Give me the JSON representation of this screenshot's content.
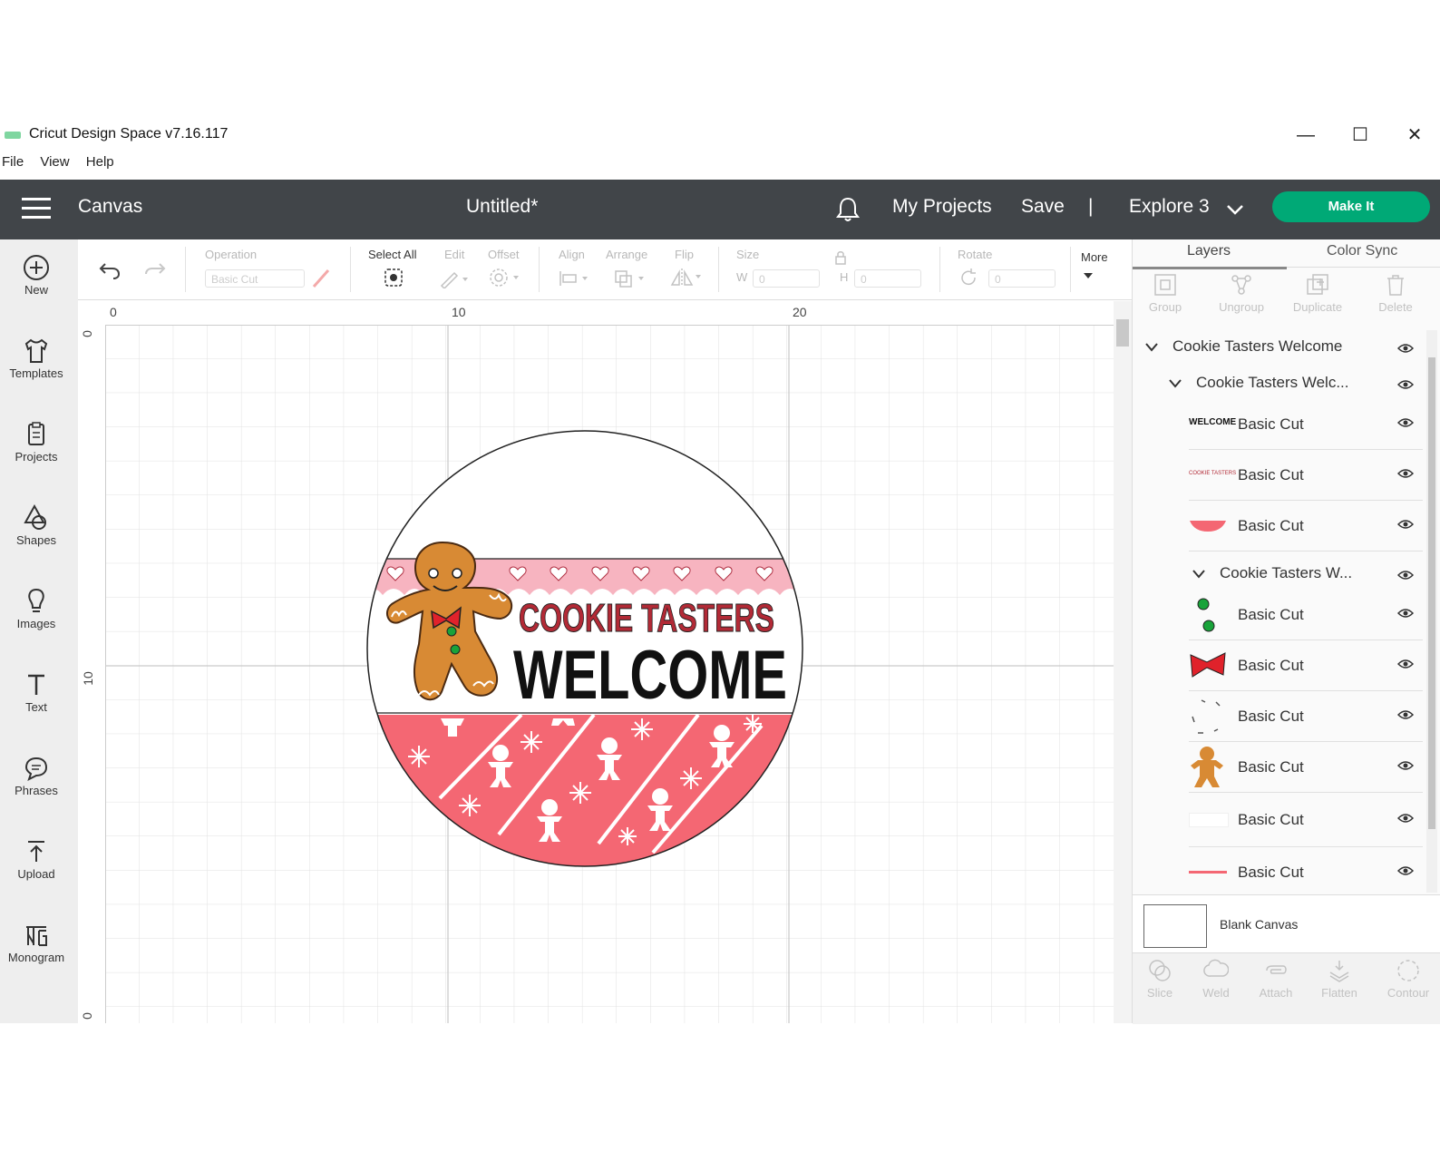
{
  "window": {
    "title": "Cricut Design Space  v7.16.117",
    "controls": [
      "minimize-icon",
      "maximize-icon",
      "close-icon"
    ]
  },
  "menu": [
    "File",
    "View",
    "Help"
  ],
  "header": {
    "section": "Canvas",
    "doc_title": "Untitled*",
    "my_projects": "My Projects",
    "save": "Save",
    "divider": "|",
    "machine": "Explore 3",
    "make_it": "Make It",
    "colors": {
      "bar": "#414549",
      "make_it": "#00a976"
    }
  },
  "sidebar": [
    {
      "label": "New",
      "icon": "plus-circle-icon"
    },
    {
      "label": "Templates",
      "icon": "shirt-icon"
    },
    {
      "label": "Projects",
      "icon": "clipboard-icon"
    },
    {
      "label": "Shapes",
      "icon": "shapes-icon"
    },
    {
      "label": "Images",
      "icon": "lightbulb-icon"
    },
    {
      "label": "Text",
      "icon": "text-icon"
    },
    {
      "label": "Phrases",
      "icon": "speech-bubble-icon"
    },
    {
      "label": "Upload",
      "icon": "upload-icon"
    },
    {
      "label": "Monogram",
      "icon": "monogram-icon"
    }
  ],
  "toolbar": {
    "operation_label": "Operation",
    "operation_value": "Basic Cut",
    "select_all": "Select All",
    "edit": "Edit",
    "offset": "Offset",
    "align": "Align",
    "arrange": "Arrange",
    "flip": "Flip",
    "size": "Size",
    "w": "W",
    "h": "H",
    "w_value": "0",
    "h_value": "0",
    "rotate": "Rotate",
    "rotate_value": "0",
    "more": "More"
  },
  "rulers": {
    "top": [
      "0",
      "10",
      "20"
    ],
    "left": [
      "0",
      "10",
      "0"
    ]
  },
  "design": {
    "line1": "COOKIE TASTERS",
    "line2": "WELCOME",
    "colors": {
      "pink": "#f46773",
      "light_pink": "#f7b4c0",
      "red_text": "#b22a36",
      "gingerbread": "#d88a34"
    }
  },
  "panel": {
    "tabs": [
      "Layers",
      "Color Sync"
    ],
    "actions": [
      "Group",
      "Ungroup",
      "Duplicate",
      "Delete"
    ],
    "layers": [
      {
        "label": "Cookie Tasters Welcome",
        "kind": "group",
        "level": 0
      },
      {
        "label": "Cookie Tasters Welc...",
        "kind": "group",
        "level": 1
      },
      {
        "label": "Basic Cut",
        "thumb": "WELCOME",
        "kind": "layer"
      },
      {
        "label": "Basic Cut",
        "thumb": "COOKIE TASTERS",
        "kind": "layer"
      },
      {
        "label": "Basic Cut",
        "thumb": "pink-band",
        "kind": "layer"
      },
      {
        "label": "Cookie Tasters W...",
        "kind": "group",
        "level": 2
      },
      {
        "label": "Basic Cut",
        "thumb": "green-buttons",
        "kind": "layer"
      },
      {
        "label": "Basic Cut",
        "thumb": "red-bow",
        "kind": "layer"
      },
      {
        "label": "Basic Cut",
        "thumb": "dashes",
        "kind": "layer"
      },
      {
        "label": "Basic Cut",
        "thumb": "gingerbread",
        "kind": "layer"
      },
      {
        "label": "Basic Cut",
        "thumb": "white",
        "kind": "layer"
      },
      {
        "label": "Basic Cut",
        "thumb": "pink-line",
        "kind": "layer"
      }
    ],
    "blank_canvas": "Blank Canvas",
    "bottom_actions": [
      "Slice",
      "Weld",
      "Attach",
      "Flatten",
      "Contour"
    ]
  }
}
